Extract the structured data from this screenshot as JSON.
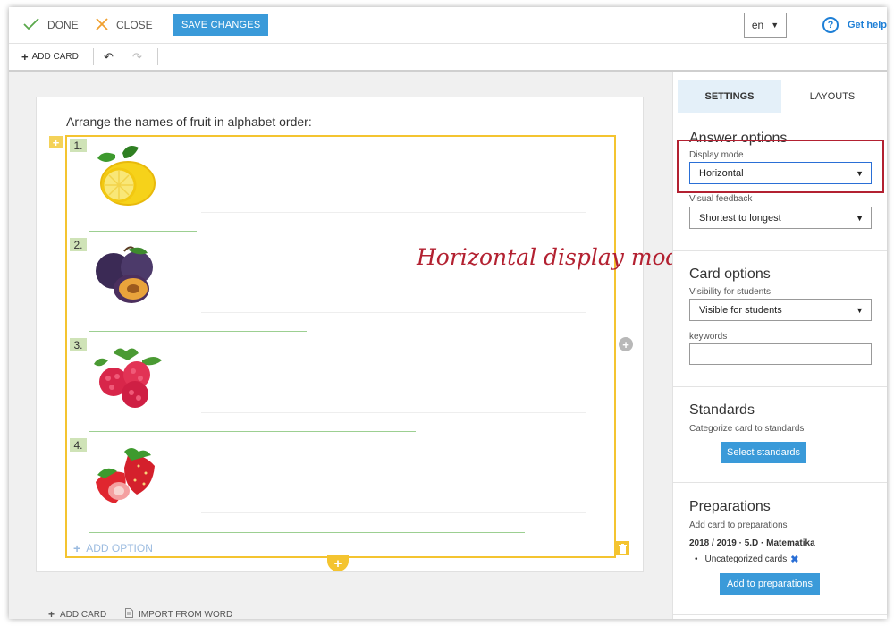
{
  "toolbar": {
    "done_label": "DONE",
    "close_label": "CLOSE",
    "save_label": "SAVE CHANGES",
    "language_value": "en",
    "help_label": "Get help"
  },
  "subtoolbar": {
    "add_card_label": "ADD CARD"
  },
  "card": {
    "question": "Arrange the names of fruit in alphabet order:",
    "items": [
      {
        "number": "1.",
        "fruit": "lemon"
      },
      {
        "number": "2.",
        "fruit": "plum"
      },
      {
        "number": "3.",
        "fruit": "raspberry"
      },
      {
        "number": "4.",
        "fruit": "strawberry"
      }
    ],
    "add_option_label": "ADD OPTION"
  },
  "annotation": "Horizontal display mode",
  "footer": {
    "add_card_label": "ADD CARD",
    "import_label": "IMPORT FROM WORD"
  },
  "panel": {
    "tabs": [
      {
        "label": "SETTINGS",
        "active": true
      },
      {
        "label": "LAYOUTS",
        "active": false
      }
    ],
    "answer_options": {
      "title": "Answer options",
      "display_mode_label": "Display mode",
      "display_mode_value": "Horizontal",
      "visual_feedback_label": "Visual feedback",
      "visual_feedback_value": "Shortest to longest"
    },
    "card_options": {
      "title": "Card options",
      "visibility_label": "Visibility for students",
      "visibility_value": "Visible for students",
      "keywords_label": "keywords",
      "keywords_value": ""
    },
    "standards": {
      "title": "Standards",
      "description": "Categorize card to standards",
      "button_label": "Select standards"
    },
    "preparations": {
      "title": "Preparations",
      "description": "Add card to preparations",
      "group": "2018 / 2019 · 5.D · Matematika",
      "item": "Uncategorized cards",
      "button_label": "Add to preparations"
    }
  },
  "colors": {
    "accent_blue": "#3a9ad9",
    "highlight_yellow": "#f4c430",
    "annotation_red": "#b32131",
    "answer_line_green": "#9ccf91"
  }
}
